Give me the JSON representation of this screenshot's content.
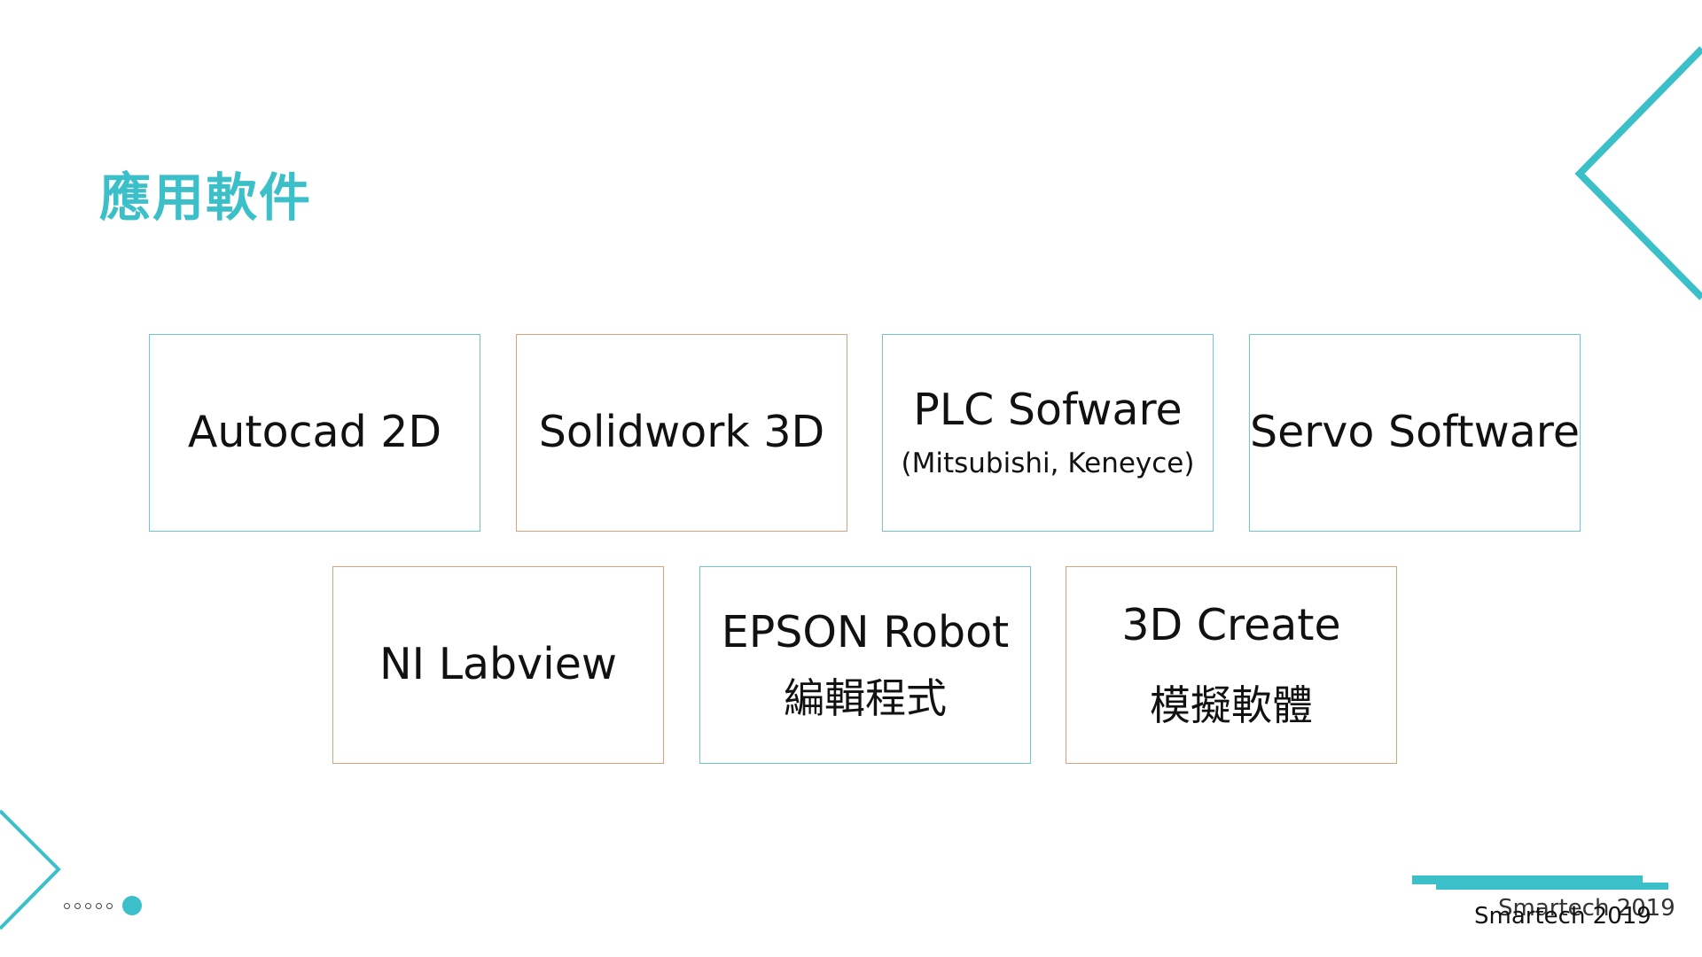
{
  "title": "應用軟件",
  "cards": [
    {
      "main": "Autocad 2D"
    },
    {
      "main": "Solidwork 3D"
    },
    {
      "main": "PLC Sofware",
      "sub": "(Mitsubishi, Keneyce)"
    },
    {
      "main": "Servo Software"
    },
    {
      "main": "NI Labview"
    },
    {
      "main": "EPSON Robot",
      "sub": "編輯程式"
    },
    {
      "main": "3D Create",
      "sub": "模擬軟體"
    }
  ],
  "footer": {
    "brand_a": "Smartech 2019",
    "brand_b": "Smartech 2019"
  },
  "colors": {
    "accent": "#3bbfc8",
    "card_border_teal": "#6cc6d3",
    "card_border_orange": "#d9a27a",
    "text": "#111111"
  },
  "pager": {
    "total": 6,
    "active": 6
  }
}
